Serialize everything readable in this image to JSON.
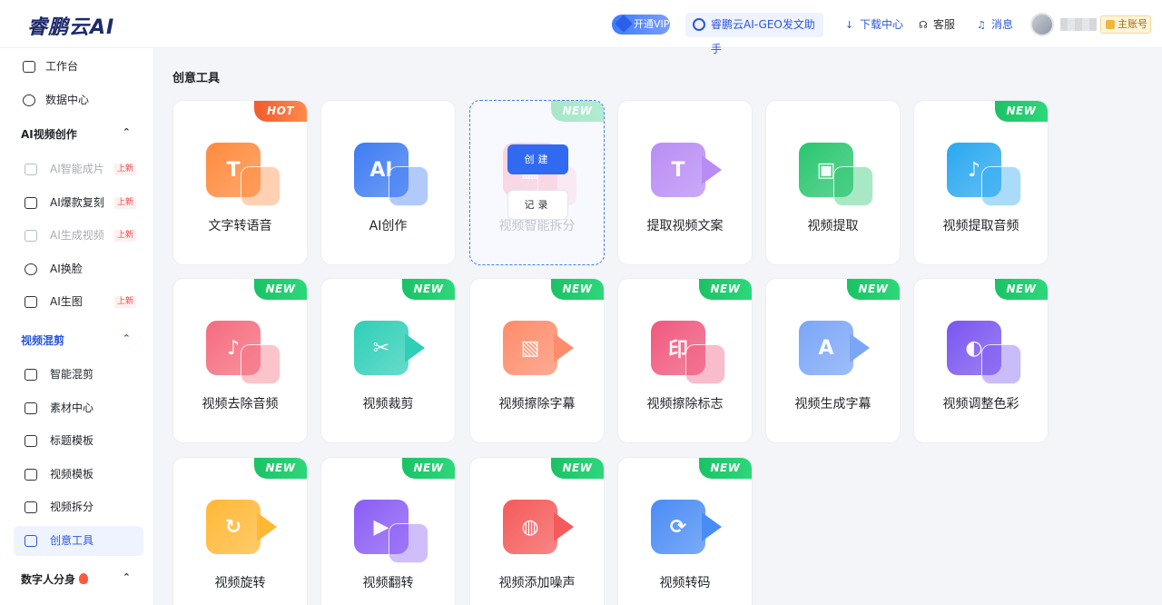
{
  "header": {
    "logo": "睿鹏云AI",
    "vip_label": "开通VIP",
    "geo_label": "睿鹏云AI-GEO发文助手",
    "download_label": "下载中心",
    "service_label": "客服",
    "message_label": "消息",
    "main_account_label": "主账号"
  },
  "sidebar": {
    "workbench": "工作台",
    "data_center": "数据中心",
    "group_ai_video": "AI视频创作",
    "ai_items": [
      {
        "label": "AI智能成片",
        "tag": "上新"
      },
      {
        "label": "AI爆款复刻",
        "tag": "上新"
      },
      {
        "label": "AI生成视频",
        "tag": "上新"
      },
      {
        "label": "AI换脸",
        "tag": ""
      },
      {
        "label": "AI生图",
        "tag": "上新"
      }
    ],
    "group_mix": "视频混剪",
    "mix_items": [
      {
        "label": "智能混剪"
      },
      {
        "label": "素材中心"
      },
      {
        "label": "标题模板"
      },
      {
        "label": "视频模板"
      },
      {
        "label": "视频拆分"
      },
      {
        "label": "创意工具"
      }
    ],
    "group_digital": "数字人分身"
  },
  "main": {
    "section_title": "创意工具",
    "hover_create": "创建",
    "hover_record": "记录",
    "tools": [
      {
        "label": "文字转语音",
        "badge": "HOT",
        "icon": "text-to-speech-icon",
        "color": "#ff8a3d"
      },
      {
        "label": "AI创作",
        "badge": "",
        "icon": "ai-create-icon",
        "color": "#3e7bf2"
      },
      {
        "label": "视频智能拆分",
        "badge": "NEW",
        "icon": "video-split-icon",
        "color": "#ff7b9c"
      },
      {
        "label": "提取视频文案",
        "badge": "",
        "icon": "extract-copy-icon",
        "color": "#b98cf5"
      },
      {
        "label": "视频提取",
        "badge": "",
        "icon": "video-extract-icon",
        "color": "#29c66f"
      },
      {
        "label": "视频提取音频",
        "badge": "NEW",
        "icon": "extract-audio-icon",
        "color": "#2aa8f0"
      },
      {
        "label": "视频去除音频",
        "badge": "NEW",
        "icon": "remove-audio-icon",
        "color": "#f56c7e"
      },
      {
        "label": "视频裁剪",
        "badge": "NEW",
        "icon": "crop-icon",
        "color": "#2fcfb7"
      },
      {
        "label": "视频擦除字幕",
        "badge": "NEW",
        "icon": "erase-subtitle-icon",
        "color": "#ff8c6b"
      },
      {
        "label": "视频擦除标志",
        "badge": "NEW",
        "icon": "erase-logo-icon",
        "color": "#f0587e"
      },
      {
        "label": "视频生成字幕",
        "badge": "NEW",
        "icon": "generate-subtitle-icon",
        "color": "#7ba6f7"
      },
      {
        "label": "视频调整色彩",
        "badge": "NEW",
        "icon": "color-adjust-icon",
        "color": "#7a55f0"
      },
      {
        "label": "视频旋转",
        "badge": "NEW",
        "icon": "rotate-icon",
        "color": "#ffb836"
      },
      {
        "label": "视频翻转",
        "badge": "NEW",
        "icon": "flip-icon",
        "color": "#8a5cf5"
      },
      {
        "label": "视频添加噪声",
        "badge": "NEW",
        "icon": "noise-icon",
        "color": "#f55a5a"
      },
      {
        "label": "视频转码",
        "badge": "NEW",
        "icon": "transcode-icon",
        "color": "#4a8cf5"
      }
    ]
  }
}
